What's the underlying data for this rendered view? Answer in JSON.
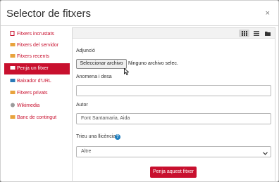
{
  "dialog": {
    "title": "Selector de fitxers",
    "close_label": "×"
  },
  "sidebar": {
    "items": [
      {
        "label": "Fitxers incrustats",
        "icon": "file-icon",
        "active": false
      },
      {
        "label": "Fitxers del servidor",
        "icon": "server-icon",
        "active": false
      },
      {
        "label": "Fitxers recents",
        "icon": "recent-icon",
        "active": false
      },
      {
        "label": "Penja un fitxer",
        "icon": "upload-icon",
        "active": true
      },
      {
        "label": "Baixador d'URL",
        "icon": "url-icon",
        "active": false
      },
      {
        "label": "Fitxers privats",
        "icon": "private-icon",
        "active": false
      },
      {
        "label": "Wikimedia",
        "icon": "wikimedia-icon",
        "active": false
      },
      {
        "label": "Banc de contingut",
        "icon": "content-bank-icon",
        "active": false
      }
    ]
  },
  "form": {
    "attachment_label": "Adjunció",
    "choose_file_label": "Seleccionar archivo",
    "no_file_text": "Ninguno archivo selec.",
    "save_as_label": "Anomena i desa",
    "save_as_value": "",
    "author_label": "Autor",
    "author_value": "Font Santamaria, Aida",
    "license_label": "Trieu una llicència",
    "license_value": "Altre",
    "submit_label": "Penja aquest fitxer"
  },
  "colors": {
    "accent": "#c8102e",
    "help": "#1f7fbf"
  }
}
